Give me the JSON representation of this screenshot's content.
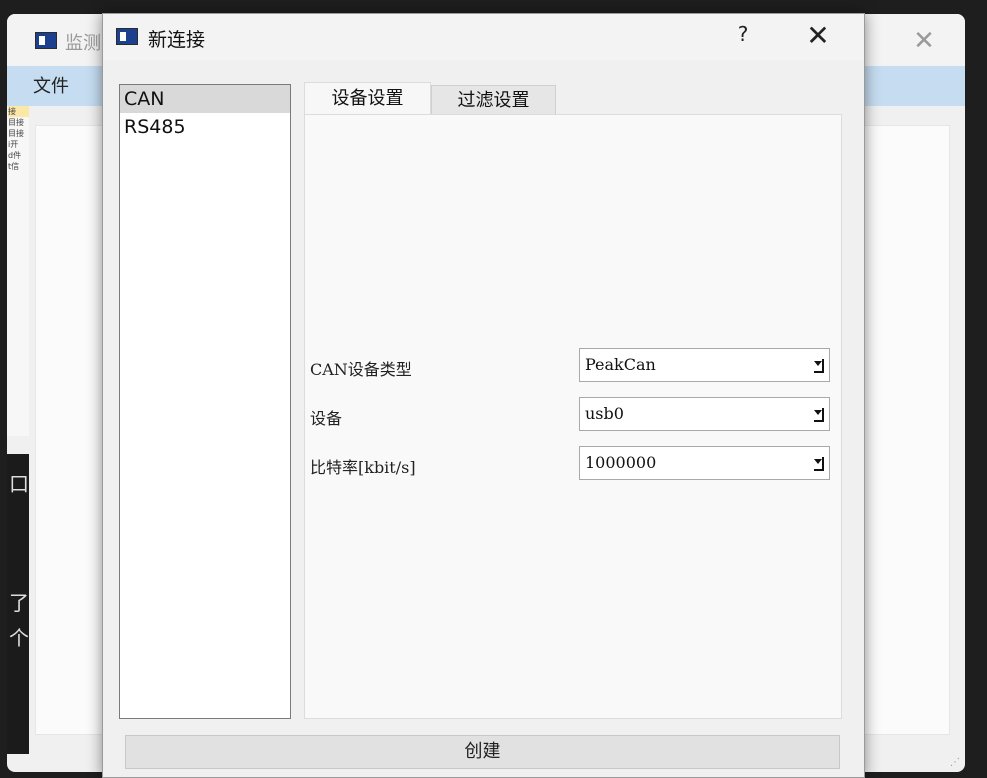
{
  "background_window": {
    "title": "监测",
    "menu": [
      "文件"
    ],
    "left_panel_fragments": [
      "接",
      "目接",
      "目接",
      "i开",
      "d件",
      "t信"
    ],
    "dark_panel_fragments": [
      "口",
      "了",
      "个"
    ]
  },
  "dialog": {
    "title": "新连接",
    "help_label": "?",
    "close_label": "✕",
    "connection_types": [
      {
        "label": "CAN",
        "selected": true
      },
      {
        "label": "RS485",
        "selected": false
      }
    ],
    "tabs": [
      {
        "label": "设备设置",
        "active": true
      },
      {
        "label": "过滤设置",
        "active": false
      }
    ],
    "fields": [
      {
        "label": "CAN设备类型",
        "value": "PeakCan"
      },
      {
        "label": "设备",
        "value": "usb0"
      },
      {
        "label": "比特率[kbit/s]",
        "value": "1000000"
      }
    ],
    "create_button": "创建"
  },
  "colors": {
    "menubar": "#c6ddf1",
    "selected_item": "#d9d9d9",
    "dialog_bg": "#f0f0f0",
    "app_icon": "#1c3f8f"
  }
}
